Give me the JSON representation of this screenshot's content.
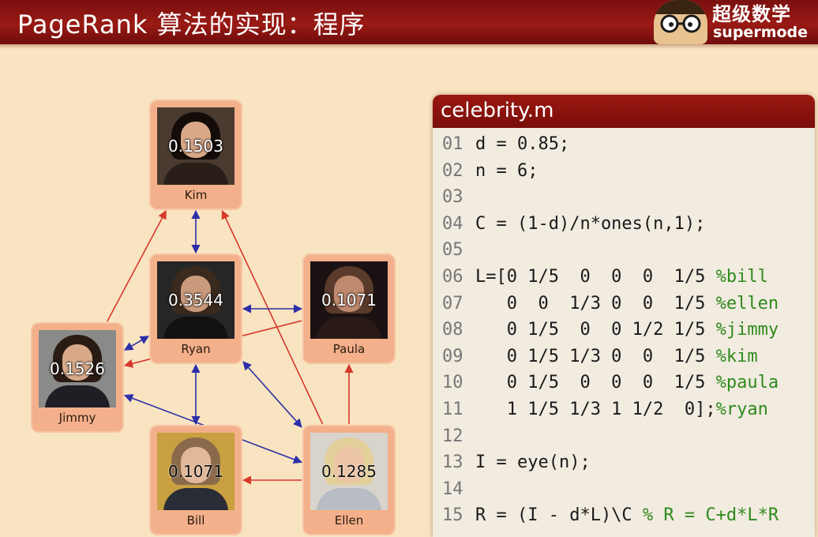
{
  "header": {
    "title": "PageRank 算法的实现：程序",
    "logo_text": "超级数学",
    "logo_subtext": "supermode"
  },
  "colors": {
    "title_bar": "#8a1410",
    "node_fill": "#f3b08a",
    "arrow_red": "#d8382c",
    "arrow_blue": "#2c2fa8",
    "comment_green": "#2f8a1c"
  },
  "graph": {
    "nodes": [
      {
        "id": "kim",
        "label": "Kim",
        "score": "0.1503"
      },
      {
        "id": "ryan",
        "label": "Ryan",
        "score": "0.3544"
      },
      {
        "id": "paula",
        "label": "Paula",
        "score": "0.1071"
      },
      {
        "id": "jimmy",
        "label": "Jimmy",
        "score": "0.1526"
      },
      {
        "id": "bill",
        "label": "Bill",
        "score": "0.1071"
      },
      {
        "id": "ellen",
        "label": "Ellen",
        "score": "0.1285"
      }
    ],
    "edges": [
      {
        "from": "jimmy",
        "to": "kim",
        "color": "red"
      },
      {
        "from": "ellen",
        "to": "kim",
        "color": "red"
      },
      {
        "from": "ellen",
        "to": "paula",
        "color": "red"
      },
      {
        "from": "ellen",
        "to": "bill",
        "color": "red"
      },
      {
        "from": "paula",
        "to": "jimmy",
        "color": "red"
      },
      {
        "from": "kim",
        "to": "ryan",
        "color": "blue",
        "bidirectional": true
      },
      {
        "from": "ryan",
        "to": "paula",
        "color": "blue",
        "bidirectional": true
      },
      {
        "from": "ryan",
        "to": "jimmy",
        "color": "blue",
        "bidirectional": true
      },
      {
        "from": "ryan",
        "to": "bill",
        "color": "blue",
        "bidirectional": true
      },
      {
        "from": "ryan",
        "to": "ellen",
        "color": "blue",
        "bidirectional": true
      },
      {
        "from": "jimmy",
        "to": "ellen",
        "color": "blue",
        "bidirectional": true
      }
    ]
  },
  "code": {
    "filename": "celebrity.m",
    "lines": [
      {
        "num": "01",
        "code": "d = 0.85;",
        "comment": ""
      },
      {
        "num": "02",
        "code": "n = 6;",
        "comment": ""
      },
      {
        "num": "03",
        "code": "",
        "comment": ""
      },
      {
        "num": "04",
        "code": "C = (1-d)/n*ones(n,1);",
        "comment": ""
      },
      {
        "num": "05",
        "code": "",
        "comment": ""
      },
      {
        "num": "06",
        "code": "L=[0 1/5  0  0  0  1/5 ",
        "comment": "%bill"
      },
      {
        "num": "07",
        "code": "   0  0  1/3 0  0  1/5 ",
        "comment": "%ellen"
      },
      {
        "num": "08",
        "code": "   0 1/5  0  0 1/2 1/5 ",
        "comment": "%jimmy"
      },
      {
        "num": "09",
        "code": "   0 1/5 1/3 0  0  1/5 ",
        "comment": "%kim"
      },
      {
        "num": "10",
        "code": "   0 1/5  0  0  0  1/5 ",
        "comment": "%paula"
      },
      {
        "num": "11",
        "code": "   1 1/5 1/3 1 1/2  0];",
        "comment": "%ryan"
      },
      {
        "num": "12",
        "code": "",
        "comment": ""
      },
      {
        "num": "13",
        "code": "I = eye(n);",
        "comment": ""
      },
      {
        "num": "14",
        "code": "",
        "comment": ""
      },
      {
        "num": "15",
        "code": "R = (I - d*L)\\C ",
        "comment": "% R = C+d*L*R"
      }
    ]
  }
}
